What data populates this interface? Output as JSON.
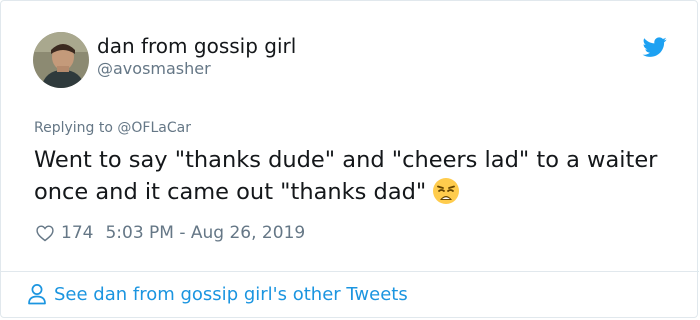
{
  "tweet": {
    "author": {
      "display_name": "dan from gossip girl",
      "handle": "@avosmasher",
      "avatar_icon": "user-avatar-photo"
    },
    "brand_icon": "twitter-bird-icon",
    "reply_prefix": "Replying to",
    "reply_to": "@OFLaCar",
    "text": "Went to say \"thanks dude\" and \"cheers lad\" to a waiter once and it came out \"thanks dad\"",
    "emoji": "weary-face-emoji",
    "like_icon": "heart-icon",
    "likes": "174",
    "timestamp": "5:03 PM - Aug 26, 2019",
    "footer_icon": "person-icon",
    "footer_link": "See dan from gossip girl's other Tweets"
  },
  "colors": {
    "primary_text": "#14171a",
    "secondary_text": "#657786",
    "link": "#1b95e0",
    "brand": "#1da1f2",
    "border": "#e1e8ed"
  }
}
